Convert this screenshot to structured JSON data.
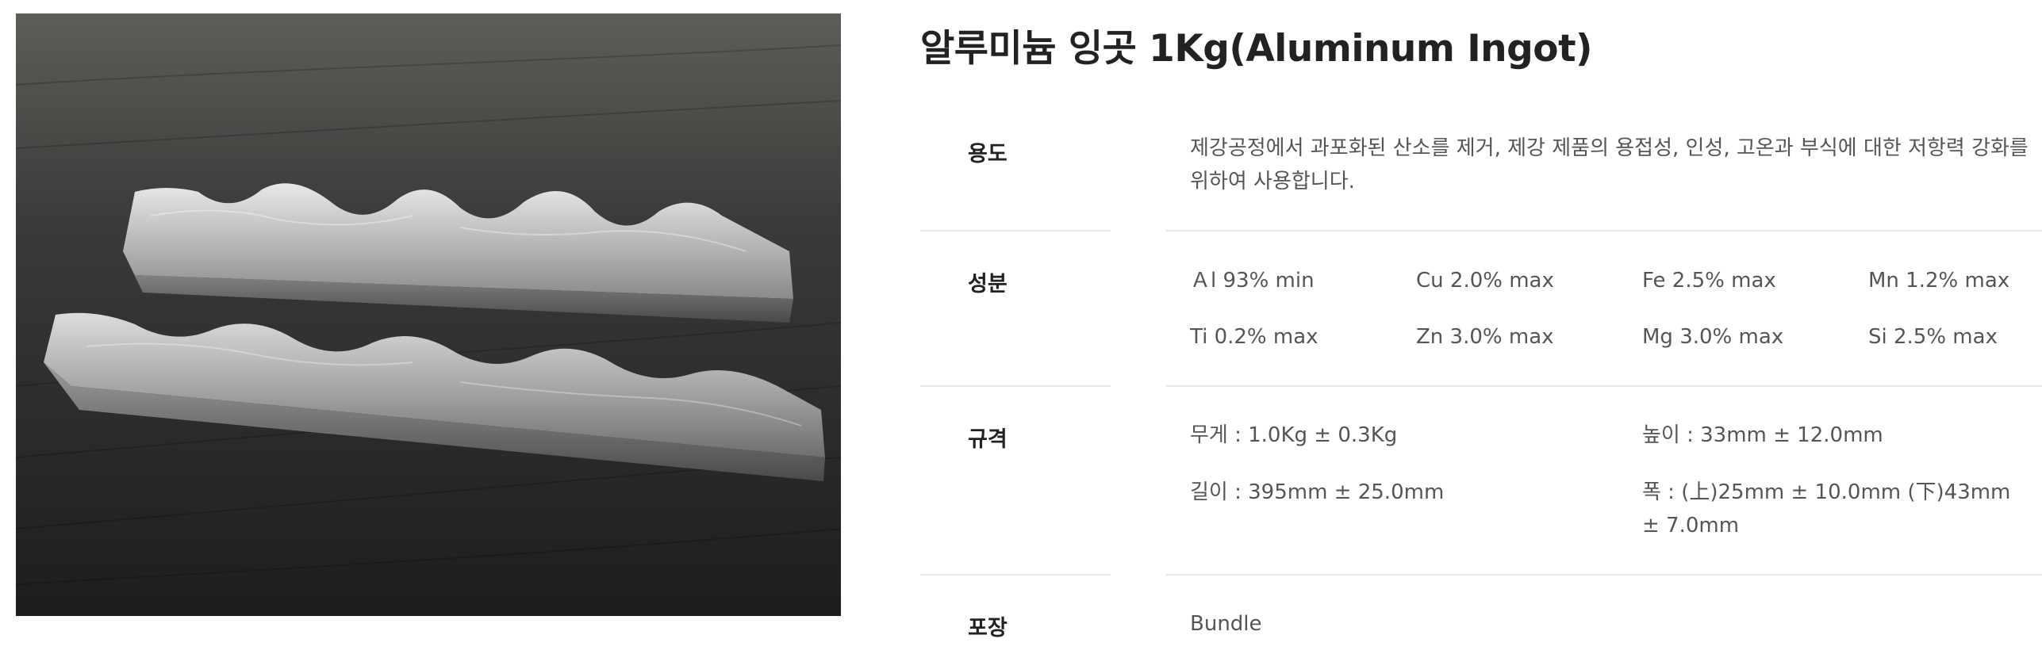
{
  "product": {
    "title": "알루미늄 잉곳 1Kg(Aluminum Ingot)",
    "image_alt": "Aluminum ingot bars on a dark surface"
  },
  "specs": {
    "usage": {
      "label": "용도",
      "text": "제강공정에서 과포화된 산소를 제거, 제강 제품의 용접성, 인성, 고온과 부식에 대한 저항력 강화를 위하여 사용합니다."
    },
    "composition": {
      "label": "성분",
      "items": [
        "Ａl 93% min",
        "Cu 2.0% max",
        "Fe 2.5% max",
        "Mn 1.2% max",
        "Ti 0.2% max",
        "Zn 3.0% max",
        "Mg 3.0% max",
        "Si 2.5% max"
      ]
    },
    "specification": {
      "label": "규격",
      "weight": "무게 : 1.0Kg ± 0.3Kg",
      "height": "높이 : 33mm ± 12.0mm",
      "length": "길이 : 395mm ± 25.0mm",
      "width": "폭 : (上)25mm ± 10.0mm (下)43mm ± 7.0mm"
    },
    "packaging": {
      "label": "포장",
      "text": "Bundle"
    }
  },
  "colors": {
    "title": "#222222",
    "label": "#222222",
    "text": "#555555",
    "divider": "#e6e6e6",
    "image_bg": "#2b2b2b"
  }
}
